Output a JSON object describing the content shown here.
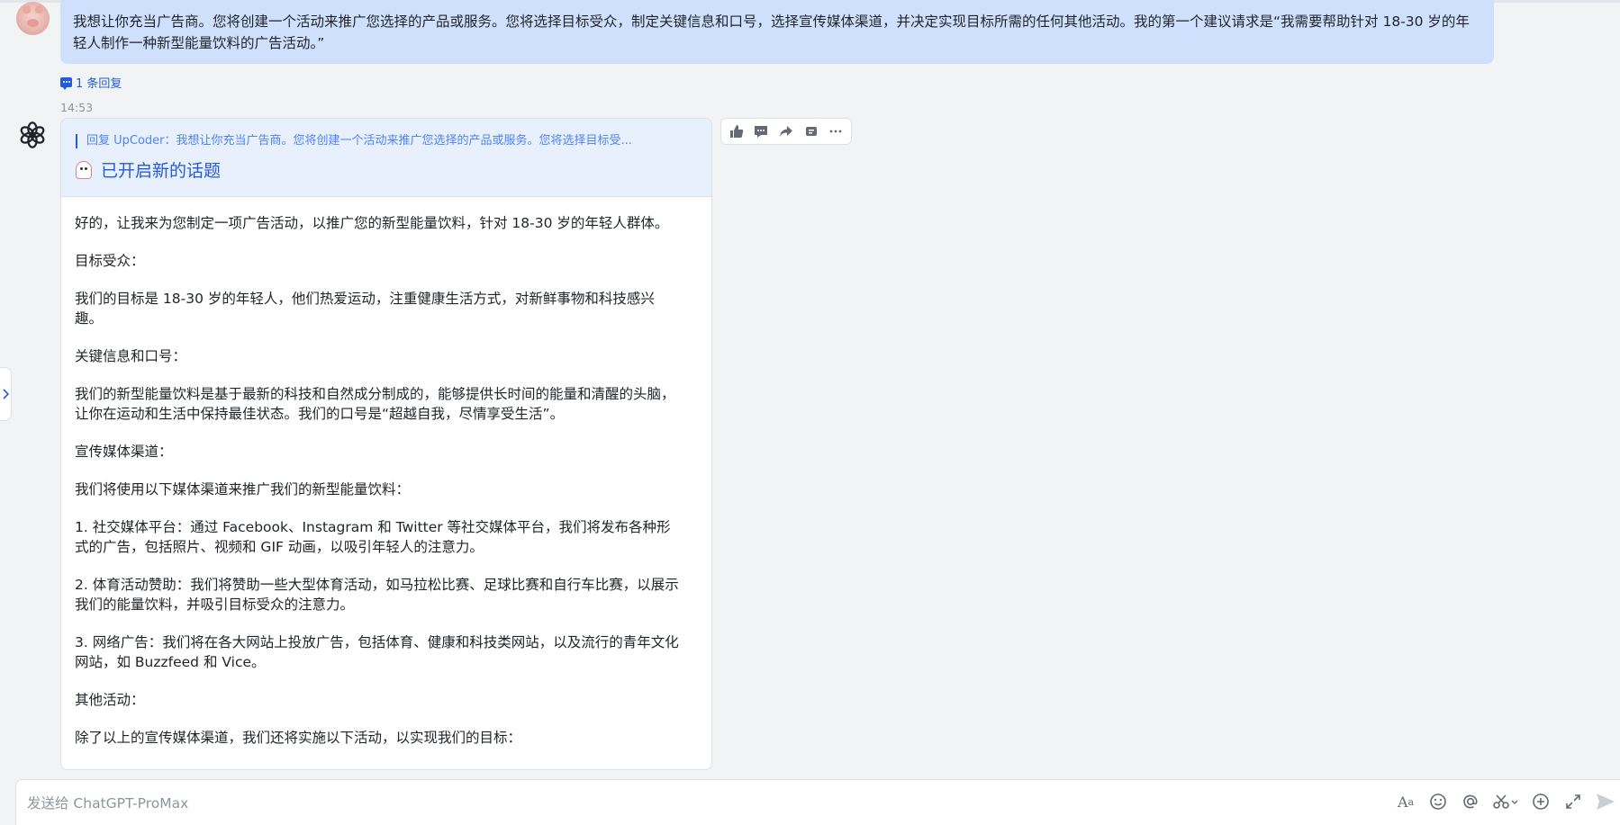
{
  "user_message": {
    "text": "我想让你充当广告商。您将创建一个活动来推广您选择的产品或服务。您将选择目标受众，制定关键信息和口号，选择宣传媒体渠道，并决定实现目标所需的任何其他活动。我的第一个建议请求是“我需要帮助针对 18-30 岁的年轻人制作一种新型能量饮料的广告活动。”",
    "reply_count": "1 条回复",
    "time": "14:53"
  },
  "bot_message": {
    "quote": "回复 UpCoder：我想让你充当广告商。您将创建一个活动来推广您选择的产品或服务。您将选择目标受...",
    "topic": "已开启新的话题",
    "paragraphs": [
      "好的，让我来为您制定一项广告活动，以推广您的新型能量饮料，针对 18-30 岁的年轻人群体。",
      "目标受众：",
      "我们的目标是 18-30 岁的年轻人，他们热爱运动，注重健康生活方式，对新鲜事物和科技感兴趣。",
      "关键信息和口号：",
      "我们的新型能量饮料是基于最新的科技和自然成分制成的，能够提供长时间的能量和清醒的头脑，让你在运动和生活中保持最佳状态。我们的口号是“超越自我，尽情享受生活”。",
      "宣传媒体渠道：",
      "我们将使用以下媒体渠道来推广我们的新型能量饮料：",
      "1. 社交媒体平台：通过 Facebook、Instagram 和 Twitter 等社交媒体平台，我们将发布各种形式的广告，包括照片、视频和 GIF 动画，以吸引年轻人的注意力。",
      "2. 体育活动赞助：我们将赞助一些大型体育活动，如马拉松比赛、足球比赛和自行车比赛，以展示我们的能量饮料，并吸引目标受众的注意力。",
      "3. 网络广告：我们将在各大网站上投放广告，包括体育、健康和科技类网站，以及流行的青年文化网站，如 Buzzfeed 和 Vice。",
      "其他活动：",
      "除了以上的宣传媒体渠道，我们还将实施以下活动，以实现我们的目标："
    ]
  },
  "actions": [
    "thumbs-up-icon",
    "comment-icon",
    "share-icon",
    "quote-icon",
    "more-icon"
  ],
  "composer": {
    "placeholder": "发送给 ChatGPT-ProMax",
    "tools": [
      "font-format-icon",
      "emoji-icon",
      "mention-icon",
      "screenshot-icon",
      "add-icon",
      "expand-icon",
      "send-icon"
    ]
  },
  "colors": {
    "accent": "#245bdb",
    "user_bubble": "#cfe0fc",
    "bot_header": "#e8effd",
    "background": "#f2f3f5"
  }
}
